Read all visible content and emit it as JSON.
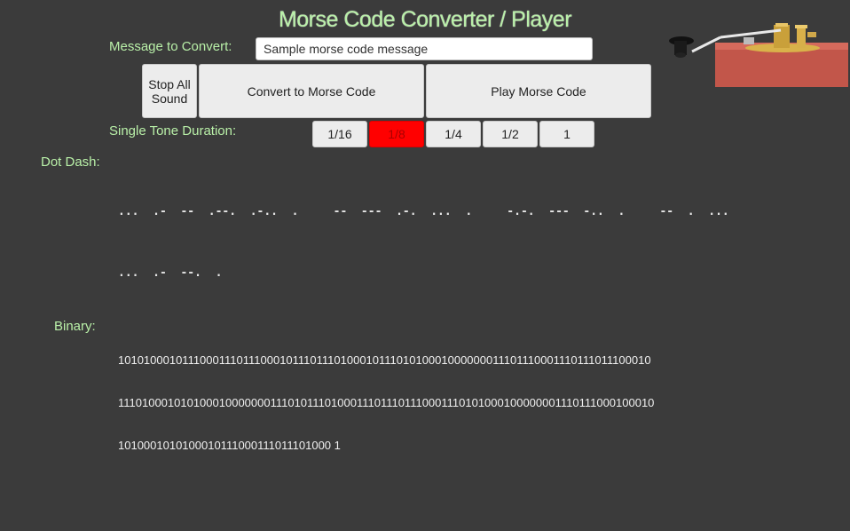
{
  "title": "Morse Code Converter / Player",
  "message": {
    "label": "Message to Convert:",
    "value": "Sample morse code message"
  },
  "buttons": {
    "stop": "Stop All Sound",
    "convert": "Convert to Morse Code",
    "play": "Play Morse Code"
  },
  "duration": {
    "label": "Single Tone Duration:",
    "options": [
      "1/16",
      "1/8",
      "1/4",
      "1/2",
      "1"
    ],
    "selected": "1/8"
  },
  "dot_dash": {
    "label": "Dot Dash:",
    "lines": [
      "...  .-  --  .--.  .-..  .     --  ---  .-.  ...  .     -.-.  ---  -..  .     --  .  ...",
      "...  .-  --.  ."
    ]
  },
  "binary": {
    "label": "Binary:",
    "lines": [
      "10101000101110001110111000101110111010001011101010001000000011101110001110111011100010",
      "11101000101010001000000011101011101000111011101110001110101000100000001110111000100010",
      "1010001010100010111000111011101000 1"
    ]
  },
  "colors": {
    "background": "#3b3b3b",
    "label": "#b9f0a8",
    "active_duration": "#ff0000"
  },
  "icons": {
    "telegraph": "telegraph-key-icon"
  }
}
